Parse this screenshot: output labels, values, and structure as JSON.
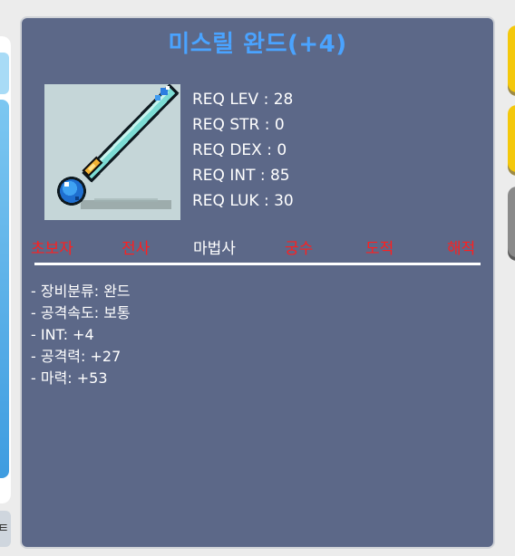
{
  "item": {
    "name": "미스릴 완드(+4)",
    "image_icon": "mithril-wand-icon"
  },
  "requirements": [
    "REQ LEV : 28",
    "REQ STR : 0",
    "REQ DEX : 0",
    "REQ INT : 85",
    "REQ LUK : 30"
  ],
  "jobs": [
    {
      "label": "초보자",
      "allowed": false
    },
    {
      "label": "전사",
      "allowed": false
    },
    {
      "label": "마법사",
      "allowed": true
    },
    {
      "label": "궁수",
      "allowed": false
    },
    {
      "label": "도적",
      "allowed": false
    },
    {
      "label": "해적",
      "allowed": false
    }
  ],
  "stats": [
    "- 장비분류: 완드",
    "- 공격속도: 보통",
    "- INT: +4",
    "- 공격력: +27",
    "- 마력: +53"
  ],
  "colors": {
    "panel_bg": "#5c6888",
    "title": "#4aa3ff",
    "job_disallowed": "#ff1f1f",
    "job_allowed": "#ffffff"
  },
  "left_panel": {
    "corner_glyph": "ㅌ"
  }
}
